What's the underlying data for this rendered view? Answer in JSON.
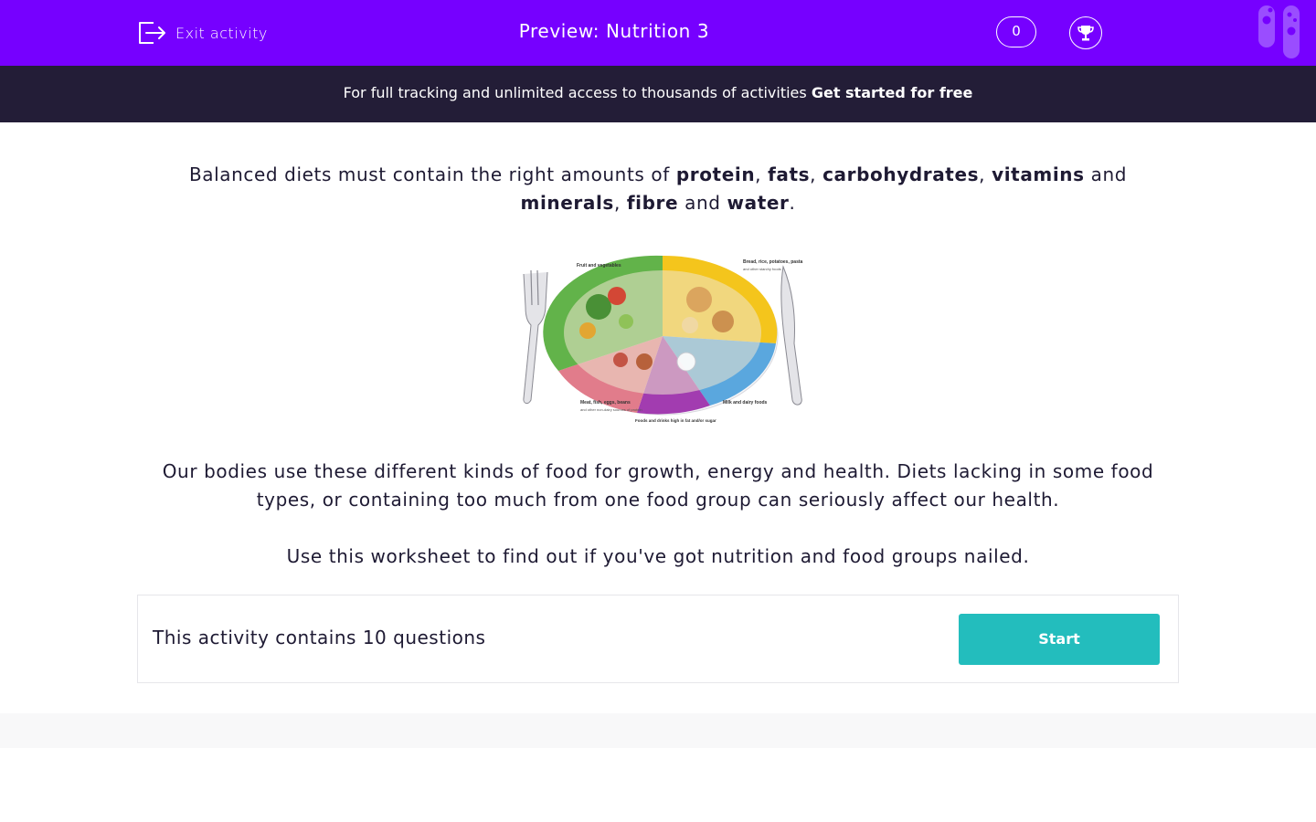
{
  "header": {
    "exit_label": "Exit activity",
    "title": "Preview: Nutrition 3",
    "score": "0",
    "exit_icon": "exit-door-icon",
    "trophy_icon": "trophy-icon",
    "logo_icon": "test-tubes-logo-icon"
  },
  "banner": {
    "text": "For full tracking and unlimited access to thousands of activities",
    "cta": "Get started for free"
  },
  "intro": {
    "prefix": "Balanced diets must contain the right amounts of",
    "items": [
      "protein",
      "fats",
      "carbohydrates",
      "vitamins",
      "minerals",
      "fibre",
      "water"
    ],
    "and": "and"
  },
  "plate_labels": {
    "fruit": "Fruit and vegetables",
    "bread": "Bread, rice, potatoes, pasta",
    "bread_sub": "and other starchy foods",
    "meat": "Meat, fish, eggs, beans",
    "meat_sub": "and other non-dairy sources of protein",
    "fats": "Foods and drinks high in fat and/or sugar",
    "milk": "Milk and dairy foods"
  },
  "body": {
    "para1": "Our bodies use these different kinds of food for growth, energy and health. Diets lacking in some food types, or containing too much from one food group can seriously affect our health.",
    "para2": "Use this worksheet to find out if you've got nutrition and food groups nailed."
  },
  "card": {
    "text": "This activity contains 10 questions",
    "button": "Start"
  },
  "colors": {
    "header_bg": "#7600ff",
    "banner_bg": "#231d37",
    "start_bg": "#23bdbd",
    "text": "#1e1a33"
  }
}
